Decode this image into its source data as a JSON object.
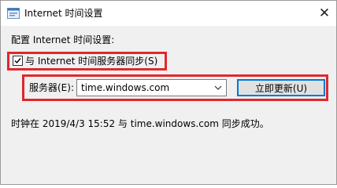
{
  "window": {
    "title": "Internet 时间设置",
    "close_glyph": "✕"
  },
  "config": {
    "heading": "配置 Internet 时间设置:"
  },
  "sync": {
    "checked": true,
    "label": "与 Internet 时间服务器同步(S)"
  },
  "server": {
    "label": "服务器(E):",
    "value": "time.windows.com",
    "update_button": "立即更新(U)"
  },
  "status": {
    "message": "时钟在 2019/4/3 15:52 与 time.windows.com 同步成功。"
  },
  "icons": {
    "app": "internet-time-settings-icon",
    "close": "close-icon",
    "checkmark": "checkmark-icon",
    "dropdown": "chevron-down-icon"
  },
  "colors": {
    "highlight_border": "#e0282c",
    "focus_border": "#0078d7",
    "dialog_background": "#f0f0f0",
    "titlebar_background": "#ffffff"
  }
}
